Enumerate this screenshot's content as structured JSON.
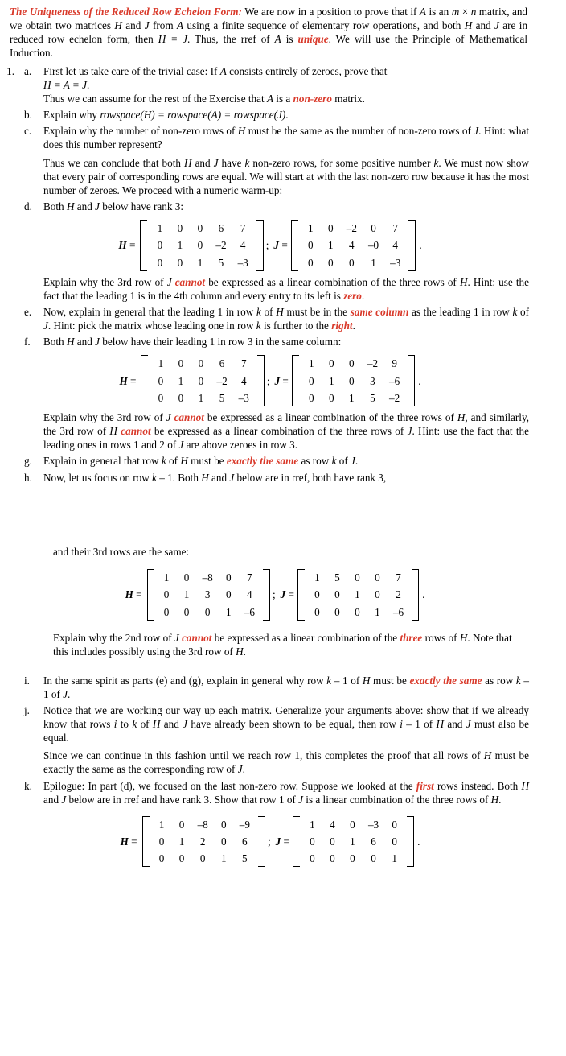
{
  "document": {
    "title": "The Uniqueness of the Reduced Row Echelon Form:",
    "intro": {
      "line1_after_title": " We are now in a position to prove that if ",
      "full": "We are now in a position to prove that if A is an m × n matrix, and we obtain two matrices H and J from A using a finite sequence of elementary row operations, and both H and J are in reduced row echelon form, then H = J. Thus, the rref of A is unique. We will use the Principle of Mathematical Induction.",
      "seg1": " We are now in a position to prove that if ",
      "var_A1": "A",
      "seg2": " is an ",
      "var_m": "m",
      "seg3": " × ",
      "var_n": "n",
      "seg4": " matrix, and we obtain two matrices ",
      "var_H1": "H",
      "seg5": " and ",
      "var_J1": "J",
      "seg6": " from ",
      "var_A2": "A",
      "seg7": " using a finite sequence of elementary row operations, and both ",
      "var_H2": "H",
      "seg8": " and ",
      "var_J2": "J",
      "seg9": " are in reduced row echelon form, then ",
      "eq_HJ": "H = J",
      "seg10": ". Thus, the rref of ",
      "var_A3": "A",
      "seg11": " is ",
      "word_unique": "unique",
      "seg12": ". We will use the Principle of Mathematical Induction."
    },
    "item_number": "1.",
    "parts": {
      "a": {
        "marker": "a.",
        "p1_seg1": "First let us take care of the trivial case: If ",
        "p1_var_A": "A",
        "p1_seg2": " consists entirely of zeroes, prove that ",
        "p1_eq": "H = A = J",
        "p1_seg3": ".",
        "p2_seg1": "Thus we can assume for the rest of the Exercise that ",
        "p2_var_A": "A",
        "p2_seg2": " is a ",
        "p2_red": "non-zero",
        "p2_seg3": " matrix."
      },
      "b": {
        "marker": "b.",
        "seg1": "Explain why ",
        "expr": "rowspace(H) = rowspace(A) = rowspace(J)",
        "seg2": "."
      },
      "c": {
        "marker": "c.",
        "seg1": "Explain why the number of non-zero rows of ",
        "var_H": "H",
        "seg2": " must be the same as the number of non-zero rows of ",
        "var_J": "J",
        "seg3": ". Hint: what does this number represent?"
      },
      "c_follow": {
        "seg1": "Thus we can conclude that both ",
        "var_H": "H",
        "seg2": " and ",
        "var_J": "J",
        "seg3": " have ",
        "var_k": "k",
        "seg4": " non-zero rows, for some positive number ",
        "var_k2": "k",
        "seg5": ". We must now show that every pair of corresponding rows are equal. We will start at with the last non-zero row because it has the most number of zeroes. We proceed with a numeric warm-up:"
      },
      "d": {
        "marker": "d.",
        "seg1": "Both ",
        "var_H": "H",
        "seg2": " and ",
        "var_J": "J",
        "seg3": " below have rank 3:",
        "after_seg1": "Explain why the 3rd row of ",
        "after_var_J": "J",
        "after_red": "cannot",
        "after_seg2": " be expressed as a linear combination of the three rows of ",
        "after_var_H": "H",
        "after_seg3": ". Hint: use the fact that the leading 1 is in the 4th column and every entry to its left is ",
        "after_red2": "zero",
        "after_seg4": "."
      },
      "e": {
        "marker": "e.",
        "seg1": "Now, explain in general that the leading 1 in row ",
        "var_k": "k",
        "seg2": " of ",
        "var_H": "H",
        "seg3": " must be in the ",
        "red1": "same column",
        "seg4": " as the leading 1 in row ",
        "var_k2": "k",
        "seg5": " of ",
        "var_J": "J",
        "seg6": ". Hint: pick the matrix whose leading one in row ",
        "var_k3": "k",
        "seg7": " is further to the ",
        "red2": "right",
        "seg8": "."
      },
      "f": {
        "marker": "f.",
        "seg1": "Both ",
        "var_H": "H",
        "seg2": " and ",
        "var_J": "J",
        "seg3": " below have their leading 1 in row 3 in the same column:",
        "after_seg1": "Explain why the 3rd row of ",
        "after_var_J1": "J",
        "after_red1": "cannot",
        "after_seg2": " be expressed as a linear combination of the three rows of ",
        "after_var_H1": "H",
        "after_seg3": ", and similarly, the 3rd row of ",
        "after_var_H2": "H",
        "after_red2": "cannot",
        "after_seg4": " be expressed as a linear combination of the three rows of ",
        "after_var_J2": "J",
        "after_seg5": ". Hint: use the fact that the leading ones in rows 1 and 2 of ",
        "after_var_J3": "J",
        "after_seg6": " are above zeroes in row 3."
      },
      "g": {
        "marker": "g.",
        "seg1": "Explain in general that row ",
        "var_k": "k",
        "seg2": " of ",
        "var_H": "H",
        "seg3": " must be ",
        "red": "exactly the same",
        "seg4": " as row ",
        "var_k2": "k",
        "seg5": " of ",
        "var_J": "J",
        "seg6": "."
      },
      "h": {
        "marker": "h.",
        "seg1": "Now, let us focus on row ",
        "var_k": "k",
        "seg2": " – 1. Both ",
        "var_H": "H",
        "seg3": " and ",
        "var_J": "J",
        "seg4": " below are in rref, both have rank 3,",
        "cont": "and their 3rd rows are the same:",
        "after_seg1": "Explain why the 2nd row of ",
        "after_var_J": "J",
        "after_red1": "cannot",
        "after_seg2": " be expressed as a linear combination of the ",
        "after_red2": "three",
        "after_seg3": " rows of ",
        "after_var_H1": "H",
        "after_seg4": ". Note that this includes possibly using the 3rd row of ",
        "after_var_H2": "H",
        "after_seg5": "."
      },
      "i": {
        "marker": "i.",
        "seg1": "In the same spirit as parts (e) and (g), explain in general why row ",
        "var_k": "k",
        "seg2": " – 1 of ",
        "var_H": "H",
        "seg3": " must be ",
        "red": "exactly the same",
        "seg4": " as row ",
        "var_k2": "k",
        "seg5": " – 1 of ",
        "var_J": "J",
        "seg6": "."
      },
      "j": {
        "marker": "j.",
        "seg1": "Notice that we are working our way up each matrix. Generalize your arguments above: show that if we already know that rows ",
        "var_i": "i",
        "seg2": " to ",
        "var_k": "k",
        "seg3": " of ",
        "var_H": "H",
        "seg4": " and ",
        "var_J": "J",
        "seg5": " have already been shown to be equal, then row ",
        "var_i2": "i",
        "seg6": " – 1 of ",
        "var_H2": "H",
        "seg7": " and ",
        "var_J2": "J",
        "seg8": " must also be equal.",
        "p2_seg1": "Since we can continue in this fashion until we reach row 1, this completes the proof that all rows of ",
        "p2_var_H": "H",
        "p2_seg2": " must be exactly the same as the corresponding row of ",
        "p2_var_J": "J",
        "p2_seg3": "."
      },
      "k": {
        "marker": "k.",
        "seg1": "Epilogue: In part (d), we focused on the last non-zero row. Suppose we looked at the ",
        "red": "first",
        "seg2": " rows instead. Both ",
        "var_H": "H",
        "seg3": " and ",
        "var_J": "J",
        "seg4": " below are in rref and have rank 3. Show that row 1 of ",
        "var_J2": "J",
        "seg5": " is a linear combination of the three rows of ",
        "var_H2": "H",
        "seg6": "."
      }
    },
    "matrices": {
      "labels": {
        "H": "H",
        "J": "J",
        "equals": "=",
        "separator": ";",
        "period": "."
      },
      "pair_d": {
        "H": [
          [
            "1",
            "0",
            "0",
            "6",
            "7"
          ],
          [
            "0",
            "1",
            "0",
            "–2",
            "4"
          ],
          [
            "0",
            "0",
            "1",
            "5",
            "–3"
          ]
        ],
        "J": [
          [
            "1",
            "0",
            "–2",
            "0",
            "7"
          ],
          [
            "0",
            "1",
            "4",
            "–0",
            "4"
          ],
          [
            "0",
            "0",
            "0",
            "1",
            "–3"
          ]
        ]
      },
      "pair_f": {
        "H": [
          [
            "1",
            "0",
            "0",
            "6",
            "7"
          ],
          [
            "0",
            "1",
            "0",
            "–2",
            "4"
          ],
          [
            "0",
            "0",
            "1",
            "5",
            "–3"
          ]
        ],
        "J": [
          [
            "1",
            "0",
            "0",
            "–2",
            "9"
          ],
          [
            "0",
            "1",
            "0",
            "3",
            "–6"
          ],
          [
            "0",
            "0",
            "1",
            "5",
            "–2"
          ]
        ]
      },
      "pair_h": {
        "H": [
          [
            "1",
            "0",
            "–8",
            "0",
            "7"
          ],
          [
            "0",
            "1",
            "3",
            "0",
            "4"
          ],
          [
            "0",
            "0",
            "0",
            "1",
            "–6"
          ]
        ],
        "J": [
          [
            "1",
            "5",
            "0",
            "0",
            "7"
          ],
          [
            "0",
            "0",
            "1",
            "0",
            "2"
          ],
          [
            "0",
            "0",
            "0",
            "1",
            "–6"
          ]
        ]
      },
      "pair_k": {
        "H": [
          [
            "1",
            "0",
            "–8",
            "0",
            "–9"
          ],
          [
            "0",
            "1",
            "2",
            "0",
            "6"
          ],
          [
            "0",
            "0",
            "0",
            "1",
            "5"
          ]
        ],
        "J": [
          [
            "1",
            "4",
            "0",
            "–3",
            "0"
          ],
          [
            "0",
            "0",
            "1",
            "6",
            "0"
          ],
          [
            "0",
            "0",
            "0",
            "0",
            "1"
          ]
        ]
      }
    },
    "colors": {
      "accent_red": "#D93A2B",
      "text": "#000000",
      "background": "#FFFFFF"
    }
  }
}
